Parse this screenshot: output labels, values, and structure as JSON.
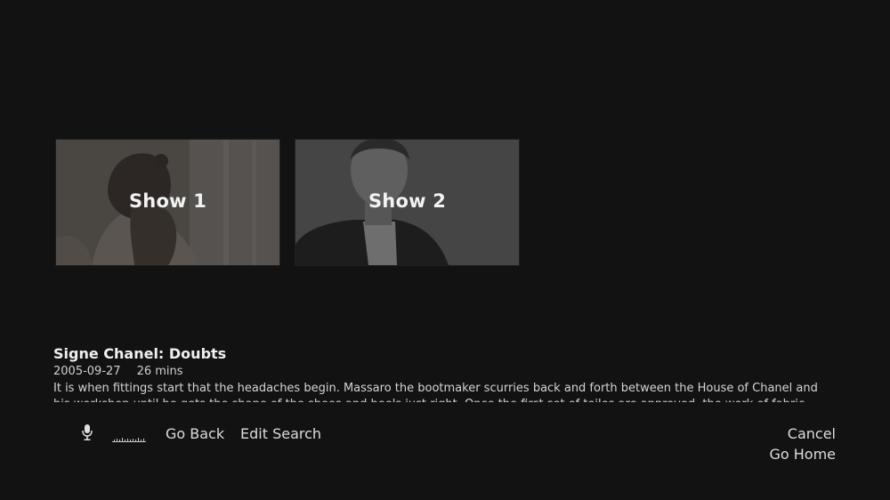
{
  "tiles": [
    {
      "label": "Show 1"
    },
    {
      "label": "Show 2"
    }
  ],
  "details": {
    "title": "Signe Chanel: Doubts",
    "date": "2005-09-27",
    "duration": "26 mins",
    "description": "It is when fittings start that the headaches begin. Massaro the bootmaker scurries back and forth between the House of Chanel and his workshop until he gets the shape of the shoes and heels just right. Once the first set of toiles are approved, the work of fabric selection can"
  },
  "commands": {
    "go_back": "Go Back",
    "edit_search": "Edit Search",
    "cancel": "Cancel",
    "go_home": "Go Home"
  },
  "icons": {
    "mic": "microphone-icon",
    "audio": "audio-level-icon"
  },
  "colors": {
    "background": "#121212",
    "text": "#d8d8d8",
    "title": "#f0f0f0"
  }
}
